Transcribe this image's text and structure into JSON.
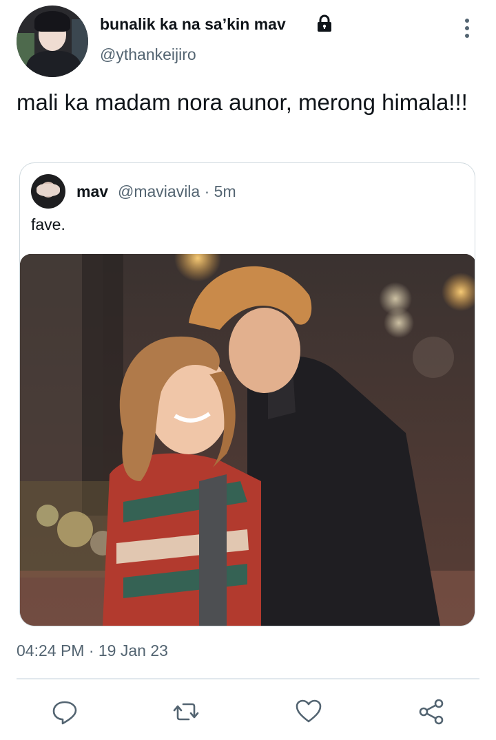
{
  "author": {
    "display_name": "bunalik ka na sa’kin mav",
    "handle": "@ythankeijiro",
    "avatar_icon": "profile-avatar",
    "protected_icon": "lock-icon"
  },
  "tweet": {
    "text": "mali ka madam nora aunor, merong himala!!!",
    "timestamp": "04:24 PM · 19 Jan 23"
  },
  "quoted_tweet": {
    "name": "mav",
    "meta": "@maviavila · 5m",
    "text": "fave.",
    "media": "photo-couple-smiling"
  },
  "actions": {
    "reply_icon": "reply-icon",
    "retweet_icon": "retweet-icon",
    "like_icon": "heart-icon",
    "share_icon": "share-icon"
  },
  "colors": {
    "text_primary": "#0f1419",
    "text_secondary": "#536471",
    "border": "#cfd9de"
  }
}
